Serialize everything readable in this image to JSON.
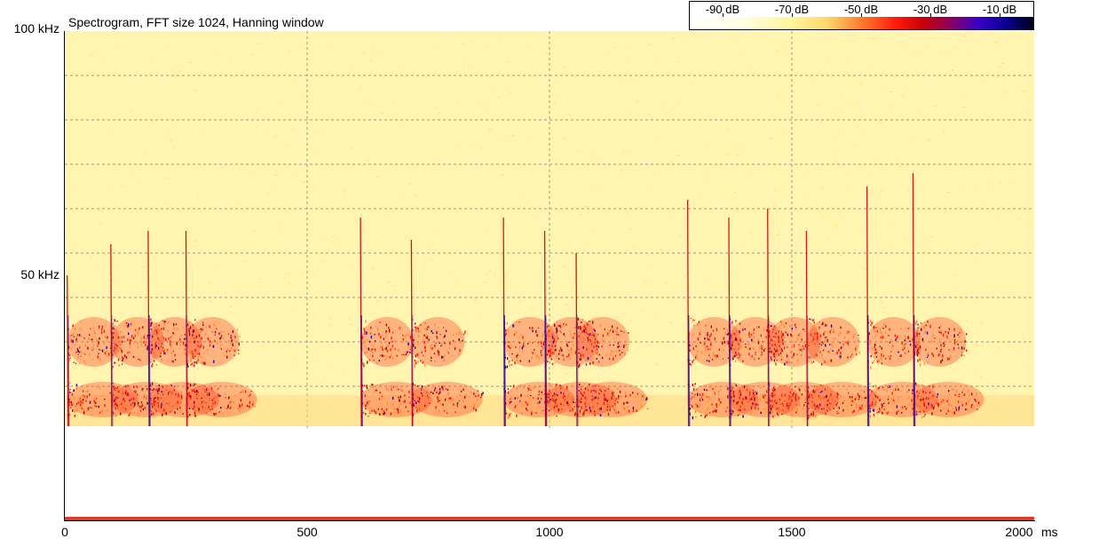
{
  "chart_data": {
    "type": "heatmap",
    "title": "Spectrogram, FFT size 1024, Hanning window",
    "xlabel": "ms",
    "ylabel": "",
    "xlim": [
      0,
      2000
    ],
    "ylim": [
      0,
      100
    ],
    "x_ticks": [
      {
        "value": 0,
        "label": "0"
      },
      {
        "value": 500,
        "label": "500"
      },
      {
        "value": 1000,
        "label": "1000"
      },
      {
        "value": 1500,
        "label": "1500"
      },
      {
        "value": 2000,
        "label": "2000"
      }
    ],
    "x_unit": "ms",
    "y_ticks": [
      {
        "value": 100,
        "label": "100 kHz"
      },
      {
        "value": 50,
        "label": "50 kHz"
      }
    ],
    "y_minor_ticks_khz": [
      10,
      20,
      30,
      40,
      50,
      60,
      70,
      80,
      90
    ],
    "grid": true,
    "colorbar": {
      "position": "top-right",
      "labels": [
        "-90 dB",
        "-70 dB",
        "-50 dB",
        "-30 dB",
        "-10 dB"
      ],
      "values_db": [
        -90,
        -70,
        -50,
        -30,
        -10
      ],
      "range_db": [
        -110,
        0
      ]
    },
    "background_level_db": -75,
    "signal_band_khz": [
      10,
      55
    ],
    "low_cutoff_khz": 11,
    "calls": [
      {
        "time_ms": 5,
        "peak_khz": 45,
        "level_db": -35
      },
      {
        "time_ms": 95,
        "peak_khz": 52,
        "level_db": -40
      },
      {
        "time_ms": 172,
        "peak_khz": 55,
        "level_db": -30
      },
      {
        "time_ms": 250,
        "peak_khz": 55,
        "level_db": -42
      },
      {
        "time_ms": 610,
        "peak_khz": 58,
        "level_db": -30
      },
      {
        "time_ms": 715,
        "peak_khz": 53,
        "level_db": -40
      },
      {
        "time_ms": 905,
        "peak_khz": 58,
        "level_db": -28
      },
      {
        "time_ms": 990,
        "peak_khz": 55,
        "level_db": -28
      },
      {
        "time_ms": 1055,
        "peak_khz": 50,
        "level_db": -40
      },
      {
        "time_ms": 1285,
        "peak_khz": 62,
        "level_db": -30
      },
      {
        "time_ms": 1370,
        "peak_khz": 58,
        "level_db": -32
      },
      {
        "time_ms": 1450,
        "peak_khz": 60,
        "level_db": -40
      },
      {
        "time_ms": 1530,
        "peak_khz": 55,
        "level_db": -42
      },
      {
        "time_ms": 1655,
        "peak_khz": 65,
        "level_db": -28
      },
      {
        "time_ms": 1750,
        "peak_khz": 68,
        "level_db": -28
      }
    ]
  },
  "colors": {
    "background_noise": "#fff4b0",
    "strong_signal": "#ff1a0a",
    "peak_signal": "#1a00b0",
    "baseline_band": "#e03a2a",
    "grid": "#9a9a9a"
  }
}
